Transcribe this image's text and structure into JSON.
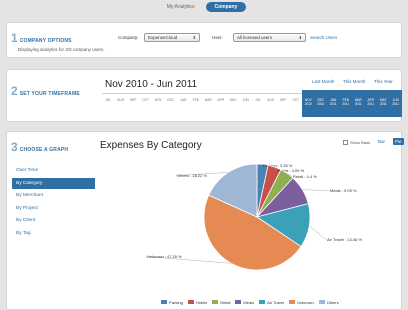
{
  "topnav": {
    "tab1": "My Analytics",
    "tab2": "Company"
  },
  "step1": {
    "num": "1",
    "title": "COMPANY OPTIONS",
    "hint": "Displaying analytics for 3/3 company users.",
    "company_label": "Company:",
    "company_value": "ExpenseCloud",
    "user_label": "User:",
    "user_value": "All licensed users",
    "search_users": "Search Users"
  },
  "step2": {
    "num": "2",
    "title": "SET YOUR TIMEFRAME",
    "range_title": "Nov 2010 - Jun 2011",
    "quick": [
      "Last Month",
      "This Month",
      "This Year"
    ],
    "months": [
      {
        "m": "JUL",
        "y": ""
      },
      {
        "m": "AUG",
        "y": ""
      },
      {
        "m": "SEP",
        "y": ""
      },
      {
        "m": "OCT",
        "y": ""
      },
      {
        "m": "NOV",
        "y": ""
      },
      {
        "m": "DEC",
        "y": ""
      },
      {
        "m": "JAN",
        "y": ""
      },
      {
        "m": "FEB",
        "y": ""
      },
      {
        "m": "MAR",
        "y": ""
      },
      {
        "m": "APR",
        "y": ""
      },
      {
        "m": "MAY",
        "y": ""
      },
      {
        "m": "JUN",
        "y": ""
      },
      {
        "m": "JUL",
        "y": ""
      },
      {
        "m": "AUG",
        "y": ""
      },
      {
        "m": "SEP",
        "y": ""
      },
      {
        "m": "OCT",
        "y": ""
      },
      {
        "m": "NOV",
        "y": "2010"
      },
      {
        "m": "DEC",
        "y": "2010"
      },
      {
        "m": "JAN",
        "y": "2011"
      },
      {
        "m": "FEB",
        "y": "2011"
      },
      {
        "m": "MAR",
        "y": "2011"
      },
      {
        "m": "APR",
        "y": "2011"
      },
      {
        "m": "MAY",
        "y": "2011"
      },
      {
        "m": "JUN",
        "y": "2011"
      }
    ],
    "selected_from_index": 16
  },
  "step3": {
    "num": "3",
    "title": "CHOOSE A GRAPH",
    "nav": [
      "Over Time",
      "By Category",
      "By Merchant",
      "By Project",
      "By Client",
      "By Tag"
    ],
    "active_nav": 1,
    "chart_title": "Expenses By Category",
    "show_bank": "Show Bank",
    "view_bar": "Bar",
    "view_pie": "Pie"
  },
  "chart_data": {
    "type": "pie",
    "title": "Expenses By Category",
    "slices": [
      {
        "name": "Parking",
        "value": 3.35,
        "label": "Parking : 3.35 %",
        "color": "#4a82b4"
      },
      {
        "name": "Hotels",
        "value": 4.09,
        "label": "Hotels : 4.09 %",
        "color": "#c8504a"
      },
      {
        "name": "Retail",
        "value": 4.4,
        "label": "Retail : 4.4 %",
        "color": "#8fb052"
      },
      {
        "name": "Meals",
        "value": 9.09,
        "label": "Meals : 9.09 %",
        "color": "#7a5e9e"
      },
      {
        "name": "Air Travel",
        "value": 13.46,
        "label": "Air Travel : 13.46 %",
        "color": "#3aa1b8"
      },
      {
        "name": "Unknown",
        "value": 47.29,
        "label": "Unknown : 47.29 %",
        "color": "#e48a52"
      },
      {
        "name": "Others",
        "value": 18.22,
        "label": "Others : 18.22 %",
        "color": "#9fb6d5"
      }
    ],
    "legend": [
      "Parking",
      "Hotels",
      "Retail",
      "Meals",
      "Air Travel",
      "Unknown",
      "Others"
    ],
    "legend_placement": "bottom"
  }
}
